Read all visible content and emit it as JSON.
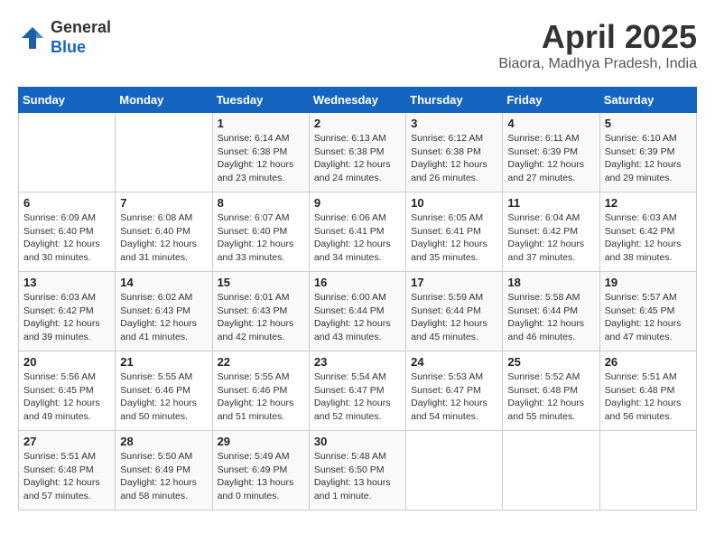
{
  "header": {
    "logo_line1": "General",
    "logo_line2": "Blue",
    "title": "April 2025",
    "location": "Biaora, Madhya Pradesh, India"
  },
  "days_of_week": [
    "Sunday",
    "Monday",
    "Tuesday",
    "Wednesday",
    "Thursday",
    "Friday",
    "Saturday"
  ],
  "weeks": [
    [
      {
        "day": "",
        "info": ""
      },
      {
        "day": "",
        "info": ""
      },
      {
        "day": "1",
        "info": "Sunrise: 6:14 AM\nSunset: 6:38 PM\nDaylight: 12 hours and 23 minutes."
      },
      {
        "day": "2",
        "info": "Sunrise: 6:13 AM\nSunset: 6:38 PM\nDaylight: 12 hours and 24 minutes."
      },
      {
        "day": "3",
        "info": "Sunrise: 6:12 AM\nSunset: 6:38 PM\nDaylight: 12 hours and 26 minutes."
      },
      {
        "day": "4",
        "info": "Sunrise: 6:11 AM\nSunset: 6:39 PM\nDaylight: 12 hours and 27 minutes."
      },
      {
        "day": "5",
        "info": "Sunrise: 6:10 AM\nSunset: 6:39 PM\nDaylight: 12 hours and 29 minutes."
      }
    ],
    [
      {
        "day": "6",
        "info": "Sunrise: 6:09 AM\nSunset: 6:40 PM\nDaylight: 12 hours and 30 minutes."
      },
      {
        "day": "7",
        "info": "Sunrise: 6:08 AM\nSunset: 6:40 PM\nDaylight: 12 hours and 31 minutes."
      },
      {
        "day": "8",
        "info": "Sunrise: 6:07 AM\nSunset: 6:40 PM\nDaylight: 12 hours and 33 minutes."
      },
      {
        "day": "9",
        "info": "Sunrise: 6:06 AM\nSunset: 6:41 PM\nDaylight: 12 hours and 34 minutes."
      },
      {
        "day": "10",
        "info": "Sunrise: 6:05 AM\nSunset: 6:41 PM\nDaylight: 12 hours and 35 minutes."
      },
      {
        "day": "11",
        "info": "Sunrise: 6:04 AM\nSunset: 6:42 PM\nDaylight: 12 hours and 37 minutes."
      },
      {
        "day": "12",
        "info": "Sunrise: 6:03 AM\nSunset: 6:42 PM\nDaylight: 12 hours and 38 minutes."
      }
    ],
    [
      {
        "day": "13",
        "info": "Sunrise: 6:03 AM\nSunset: 6:42 PM\nDaylight: 12 hours and 39 minutes."
      },
      {
        "day": "14",
        "info": "Sunrise: 6:02 AM\nSunset: 6:43 PM\nDaylight: 12 hours and 41 minutes."
      },
      {
        "day": "15",
        "info": "Sunrise: 6:01 AM\nSunset: 6:43 PM\nDaylight: 12 hours and 42 minutes."
      },
      {
        "day": "16",
        "info": "Sunrise: 6:00 AM\nSunset: 6:44 PM\nDaylight: 12 hours and 43 minutes."
      },
      {
        "day": "17",
        "info": "Sunrise: 5:59 AM\nSunset: 6:44 PM\nDaylight: 12 hours and 45 minutes."
      },
      {
        "day": "18",
        "info": "Sunrise: 5:58 AM\nSunset: 6:44 PM\nDaylight: 12 hours and 46 minutes."
      },
      {
        "day": "19",
        "info": "Sunrise: 5:57 AM\nSunset: 6:45 PM\nDaylight: 12 hours and 47 minutes."
      }
    ],
    [
      {
        "day": "20",
        "info": "Sunrise: 5:56 AM\nSunset: 6:45 PM\nDaylight: 12 hours and 49 minutes."
      },
      {
        "day": "21",
        "info": "Sunrise: 5:55 AM\nSunset: 6:46 PM\nDaylight: 12 hours and 50 minutes."
      },
      {
        "day": "22",
        "info": "Sunrise: 5:55 AM\nSunset: 6:46 PM\nDaylight: 12 hours and 51 minutes."
      },
      {
        "day": "23",
        "info": "Sunrise: 5:54 AM\nSunset: 6:47 PM\nDaylight: 12 hours and 52 minutes."
      },
      {
        "day": "24",
        "info": "Sunrise: 5:53 AM\nSunset: 6:47 PM\nDaylight: 12 hours and 54 minutes."
      },
      {
        "day": "25",
        "info": "Sunrise: 5:52 AM\nSunset: 6:48 PM\nDaylight: 12 hours and 55 minutes."
      },
      {
        "day": "26",
        "info": "Sunrise: 5:51 AM\nSunset: 6:48 PM\nDaylight: 12 hours and 56 minutes."
      }
    ],
    [
      {
        "day": "27",
        "info": "Sunrise: 5:51 AM\nSunset: 6:48 PM\nDaylight: 12 hours and 57 minutes."
      },
      {
        "day": "28",
        "info": "Sunrise: 5:50 AM\nSunset: 6:49 PM\nDaylight: 12 hours and 58 minutes."
      },
      {
        "day": "29",
        "info": "Sunrise: 5:49 AM\nSunset: 6:49 PM\nDaylight: 13 hours and 0 minutes."
      },
      {
        "day": "30",
        "info": "Sunrise: 5:48 AM\nSunset: 6:50 PM\nDaylight: 13 hours and 1 minute."
      },
      {
        "day": "",
        "info": ""
      },
      {
        "day": "",
        "info": ""
      },
      {
        "day": "",
        "info": ""
      }
    ]
  ]
}
